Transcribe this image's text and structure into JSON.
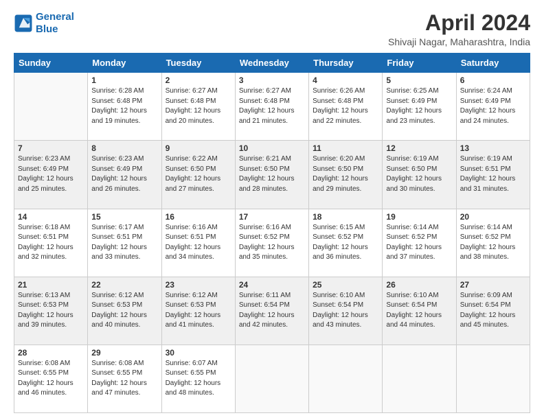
{
  "logo": {
    "line1": "General",
    "line2": "Blue"
  },
  "title": "April 2024",
  "subtitle": "Shivaji Nagar, Maharashtra, India",
  "days_header": [
    "Sunday",
    "Monday",
    "Tuesday",
    "Wednesday",
    "Thursday",
    "Friday",
    "Saturday"
  ],
  "weeks": [
    [
      {
        "num": "",
        "empty": true
      },
      {
        "num": "1",
        "sunrise": "6:28 AM",
        "sunset": "6:48 PM",
        "daylight": "12 hours and 19 minutes."
      },
      {
        "num": "2",
        "sunrise": "6:27 AM",
        "sunset": "6:48 PM",
        "daylight": "12 hours and 20 minutes."
      },
      {
        "num": "3",
        "sunrise": "6:27 AM",
        "sunset": "6:48 PM",
        "daylight": "12 hours and 21 minutes."
      },
      {
        "num": "4",
        "sunrise": "6:26 AM",
        "sunset": "6:48 PM",
        "daylight": "12 hours and 22 minutes."
      },
      {
        "num": "5",
        "sunrise": "6:25 AM",
        "sunset": "6:49 PM",
        "daylight": "12 hours and 23 minutes."
      },
      {
        "num": "6",
        "sunrise": "6:24 AM",
        "sunset": "6:49 PM",
        "daylight": "12 hours and 24 minutes."
      }
    ],
    [
      {
        "num": "7",
        "sunrise": "6:23 AM",
        "sunset": "6:49 PM",
        "daylight": "12 hours and 25 minutes."
      },
      {
        "num": "8",
        "sunrise": "6:23 AM",
        "sunset": "6:49 PM",
        "daylight": "12 hours and 26 minutes."
      },
      {
        "num": "9",
        "sunrise": "6:22 AM",
        "sunset": "6:50 PM",
        "daylight": "12 hours and 27 minutes."
      },
      {
        "num": "10",
        "sunrise": "6:21 AM",
        "sunset": "6:50 PM",
        "daylight": "12 hours and 28 minutes."
      },
      {
        "num": "11",
        "sunrise": "6:20 AM",
        "sunset": "6:50 PM",
        "daylight": "12 hours and 29 minutes."
      },
      {
        "num": "12",
        "sunrise": "6:19 AM",
        "sunset": "6:50 PM",
        "daylight": "12 hours and 30 minutes."
      },
      {
        "num": "13",
        "sunrise": "6:19 AM",
        "sunset": "6:51 PM",
        "daylight": "12 hours and 31 minutes."
      }
    ],
    [
      {
        "num": "14",
        "sunrise": "6:18 AM",
        "sunset": "6:51 PM",
        "daylight": "12 hours and 32 minutes."
      },
      {
        "num": "15",
        "sunrise": "6:17 AM",
        "sunset": "6:51 PM",
        "daylight": "12 hours and 33 minutes."
      },
      {
        "num": "16",
        "sunrise": "6:16 AM",
        "sunset": "6:51 PM",
        "daylight": "12 hours and 34 minutes."
      },
      {
        "num": "17",
        "sunrise": "6:16 AM",
        "sunset": "6:52 PM",
        "daylight": "12 hours and 35 minutes."
      },
      {
        "num": "18",
        "sunrise": "6:15 AM",
        "sunset": "6:52 PM",
        "daylight": "12 hours and 36 minutes."
      },
      {
        "num": "19",
        "sunrise": "6:14 AM",
        "sunset": "6:52 PM",
        "daylight": "12 hours and 37 minutes."
      },
      {
        "num": "20",
        "sunrise": "6:14 AM",
        "sunset": "6:52 PM",
        "daylight": "12 hours and 38 minutes."
      }
    ],
    [
      {
        "num": "21",
        "sunrise": "6:13 AM",
        "sunset": "6:53 PM",
        "daylight": "12 hours and 39 minutes."
      },
      {
        "num": "22",
        "sunrise": "6:12 AM",
        "sunset": "6:53 PM",
        "daylight": "12 hours and 40 minutes."
      },
      {
        "num": "23",
        "sunrise": "6:12 AM",
        "sunset": "6:53 PM",
        "daylight": "12 hours and 41 minutes."
      },
      {
        "num": "24",
        "sunrise": "6:11 AM",
        "sunset": "6:54 PM",
        "daylight": "12 hours and 42 minutes."
      },
      {
        "num": "25",
        "sunrise": "6:10 AM",
        "sunset": "6:54 PM",
        "daylight": "12 hours and 43 minutes."
      },
      {
        "num": "26",
        "sunrise": "6:10 AM",
        "sunset": "6:54 PM",
        "daylight": "12 hours and 44 minutes."
      },
      {
        "num": "27",
        "sunrise": "6:09 AM",
        "sunset": "6:54 PM",
        "daylight": "12 hours and 45 minutes."
      }
    ],
    [
      {
        "num": "28",
        "sunrise": "6:08 AM",
        "sunset": "6:55 PM",
        "daylight": "12 hours and 46 minutes."
      },
      {
        "num": "29",
        "sunrise": "6:08 AM",
        "sunset": "6:55 PM",
        "daylight": "12 hours and 47 minutes."
      },
      {
        "num": "30",
        "sunrise": "6:07 AM",
        "sunset": "6:55 PM",
        "daylight": "12 hours and 48 minutes."
      },
      {
        "num": "",
        "empty": true
      },
      {
        "num": "",
        "empty": true
      },
      {
        "num": "",
        "empty": true
      },
      {
        "num": "",
        "empty": true
      }
    ]
  ]
}
